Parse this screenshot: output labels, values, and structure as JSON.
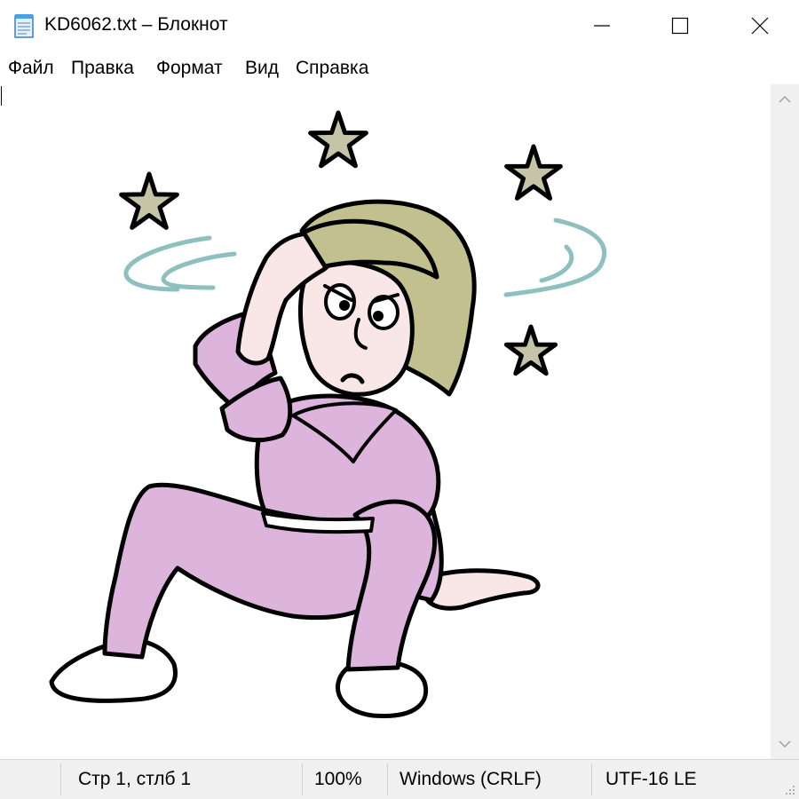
{
  "window": {
    "title": "KD6062.txt – Блокнот",
    "controls": {
      "minimize": "minimize",
      "maximize": "maximize",
      "close": "close"
    }
  },
  "menu": {
    "items": [
      "Файл",
      "Правка",
      "Формат",
      "Вид",
      "Справка"
    ]
  },
  "editor": {
    "content_image": "dizzy-woman-sitting-with-stars-ascii-art",
    "colors": {
      "outfit": "#dcb4dc",
      "hair": "#c2c08e",
      "stars": "#c5c4a6",
      "swirls": "#8fc0c0",
      "skin": "#f9e6e6"
    }
  },
  "status": {
    "position": "Стр 1, стлб 1",
    "zoom": "100%",
    "line_endings": "Windows (CRLF)",
    "encoding": "UTF-16 LE"
  }
}
